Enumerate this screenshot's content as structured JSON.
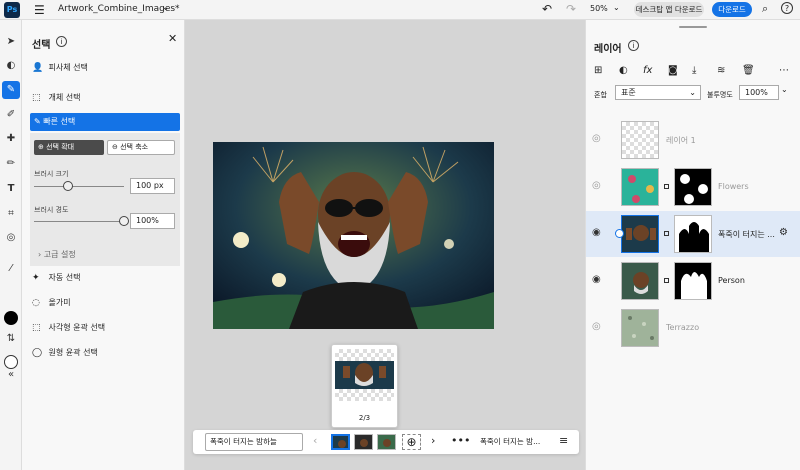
{
  "app": {
    "logo": "Ps",
    "document_title": "Artwork_Combine_Images*",
    "zoom": "50%",
    "desktop_button": "데스크탑 앱 다운로드",
    "download_button": "다운로드"
  },
  "colors": {
    "accent": "#1473e6",
    "foreground_swatch": "#000000",
    "background_swatch": "#ffffff"
  },
  "toolrail": {
    "icons": [
      "move-icon",
      "adjust-icon",
      "quick-selection-icon",
      "brush-retouch-icon",
      "healing-icon",
      "brush-icon",
      "type-icon",
      "crop-icon",
      "clone-icon",
      "eyedropper-icon",
      "swap-icon",
      "collapse-icon"
    ]
  },
  "selection_panel": {
    "title": "선택",
    "items_top": [
      {
        "label": "피사체 선택",
        "icon": "person-icon"
      },
      {
        "label": "개체 선택",
        "icon": "object-select-icon"
      }
    ],
    "active_item": "빠른 선택",
    "add_button": "선택 확대",
    "subtract_button": "선택 축소",
    "brush_size_label": "브러시 크기",
    "brush_size_value": "100 px",
    "brush_size_level": 0.38,
    "brush_hardness_label": "브러시 경도",
    "brush_hardness_value": "100%",
    "brush_hardness_level": 1.0,
    "advanced": "고급 설정",
    "items_bottom": [
      {
        "label": "자동 선택",
        "icon": "magic-wand-icon"
      },
      {
        "label": "올가미",
        "icon": "lasso-icon"
      },
      {
        "label": "사각형 윤곽 선택",
        "icon": "rect-marquee-icon"
      },
      {
        "label": "원형 윤곽 선택",
        "icon": "ellipse-marquee-icon"
      }
    ]
  },
  "canvas": {
    "preview_count": "2/3"
  },
  "bottombar": {
    "artboard_name": "폭죽이 터지는 밤하늘",
    "layer_name": "폭죽이 터지는 밤..."
  },
  "layers_panel": {
    "title": "레이어",
    "blend_label": "혼합",
    "blend_value": "표준",
    "opacity_label": "불투명도",
    "opacity_value": "100%",
    "layers": [
      {
        "name": "레이어 1",
        "visible": false,
        "selected": false
      },
      {
        "name": "Flowers",
        "visible": false,
        "selected": false
      },
      {
        "name": "폭죽이 터지는 ...",
        "visible": true,
        "selected": true
      },
      {
        "name": "Person",
        "visible": true,
        "selected": false
      },
      {
        "name": "Terrazzo",
        "visible": false,
        "selected": false
      }
    ]
  }
}
